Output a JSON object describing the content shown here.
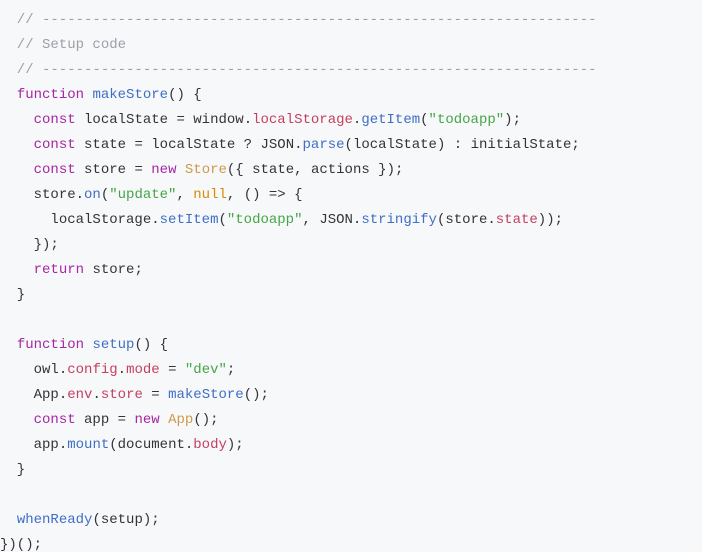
{
  "code": {
    "l1": "  // ------------------------------------------------------------------",
    "l2": "  // Setup code",
    "l3": "  // ------------------------------------------------------------------",
    "l4_kw": "function",
    "l4_fn": "makeStore",
    "l5_kw": "const",
    "l5_v": "localState",
    "l5_win": "window",
    "l5_ls": "localStorage",
    "l5_get": "getItem",
    "l5_s": "\"todoapp\"",
    "l6_kw": "const",
    "l6_v": "state",
    "l6_ls": "localState",
    "l6_json": "JSON",
    "l6_parse": "parse",
    "l6_arg": "localState",
    "l6_init": "initialState",
    "l7_kw": "const",
    "l7_v": "store",
    "l7_new": "new",
    "l7_cls": "Store",
    "l7_a1": "state",
    "l7_a2": "actions",
    "l8_obj": "store",
    "l8_on": "on",
    "l8_s": "\"update\"",
    "l8_null": "null",
    "l9_ls": "localStorage",
    "l9_set": "setItem",
    "l9_s": "\"todoapp\"",
    "l9_json": "JSON",
    "l9_stringify": "stringify",
    "l9_store": "store",
    "l9_state": "state",
    "l11_kw": "return",
    "l11_v": "store",
    "l14_kw": "function",
    "l14_fn": "setup",
    "l15_owl": "owl",
    "l15_cfg": "config",
    "l15_mode": "mode",
    "l15_s": "\"dev\"",
    "l16_app": "App",
    "l16_env": "env",
    "l16_store": "store",
    "l16_mk": "makeStore",
    "l17_kw": "const",
    "l17_v": "app",
    "l17_new": "new",
    "l17_cls": "App",
    "l18_app": "app",
    "l18_mount": "mount",
    "l18_doc": "document",
    "l18_body": "body",
    "l21_when": "whenReady",
    "l21_arg": "setup"
  }
}
